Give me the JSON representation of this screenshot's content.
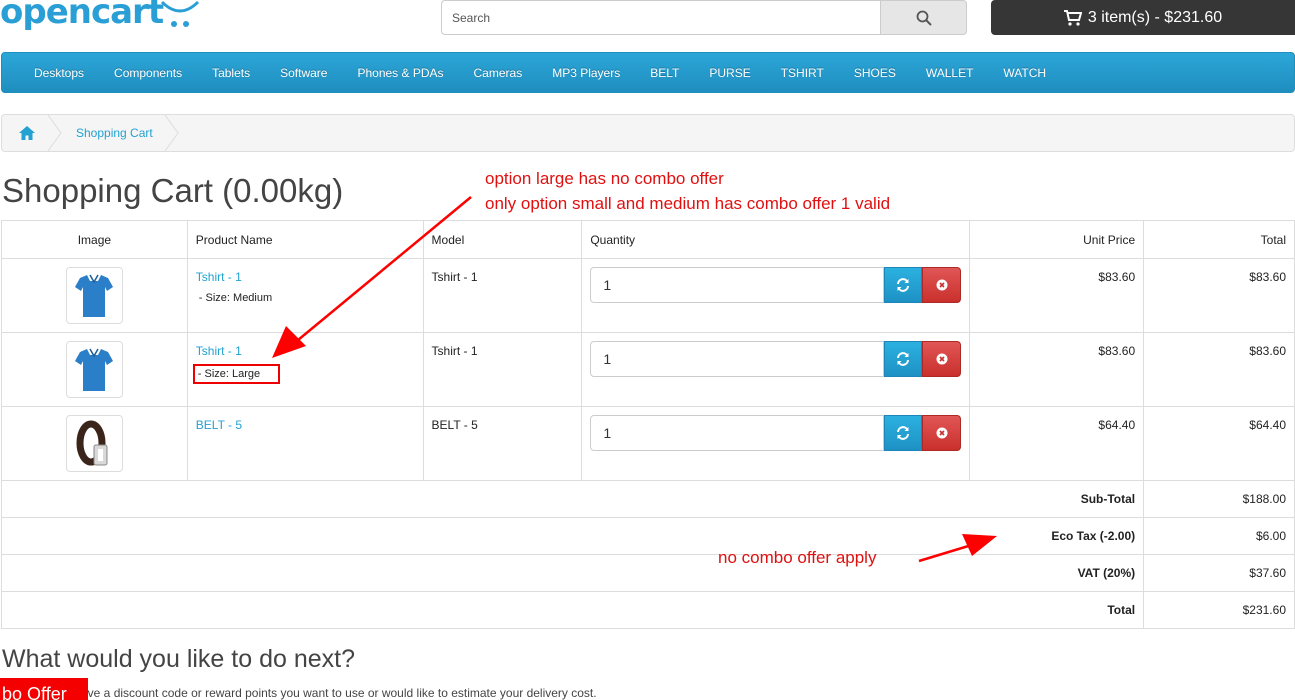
{
  "header": {
    "logo": "opencart",
    "search_placeholder": "Search",
    "cart_label": "3 item(s) - $231.60"
  },
  "menu": [
    "Desktops",
    "Components",
    "Tablets",
    "Software",
    "Phones & PDAs",
    "Cameras",
    "MP3 Players",
    "BELT",
    "PURSE",
    "TSHIRT",
    "SHOES",
    "WALLET",
    "WATCH"
  ],
  "breadcrumb": {
    "current": "Shopping Cart"
  },
  "page_title": "Shopping Cart (0.00kg)",
  "table": {
    "headers": {
      "image": "Image",
      "name": "Product Name",
      "model": "Model",
      "quantity": "Quantity",
      "unit_price": "Unit Price",
      "total": "Total"
    },
    "rows": [
      {
        "name": "Tshirt - 1",
        "option": "- Size: Medium",
        "model": "Tshirt - 1",
        "qty": "1",
        "unit_price": "$83.60",
        "total": "$83.60"
      },
      {
        "name": "Tshirt - 1",
        "option": "- Size: Large",
        "model": "Tshirt - 1",
        "qty": "1",
        "unit_price": "$83.60",
        "total": "$83.60"
      },
      {
        "name": "BELT - 5",
        "option": "",
        "model": "BELT - 5",
        "qty": "1",
        "unit_price": "$64.40",
        "total": "$64.40"
      }
    ],
    "totals": [
      {
        "label": "Sub-Total",
        "value": "$188.00"
      },
      {
        "label": "Eco Tax (-2.00)",
        "value": "$6.00"
      },
      {
        "label": "VAT (20%)",
        "value": "$37.60"
      },
      {
        "label": "Total",
        "value": "$231.60"
      }
    ]
  },
  "next": {
    "heading": "What would you like to do next?",
    "text": "ave a discount code or reward points you want to use or would like to estimate your delivery cost.",
    "combo_tab": "bo Offer"
  },
  "annotations": {
    "line1": "option large has no combo offer",
    "line2": "only option small and medium has combo offer 1 valid",
    "note": "no combo offer apply"
  },
  "colors": {
    "accent": "#23a1d1",
    "menu": "#2ca6d8",
    "annotation": "#e01010"
  }
}
